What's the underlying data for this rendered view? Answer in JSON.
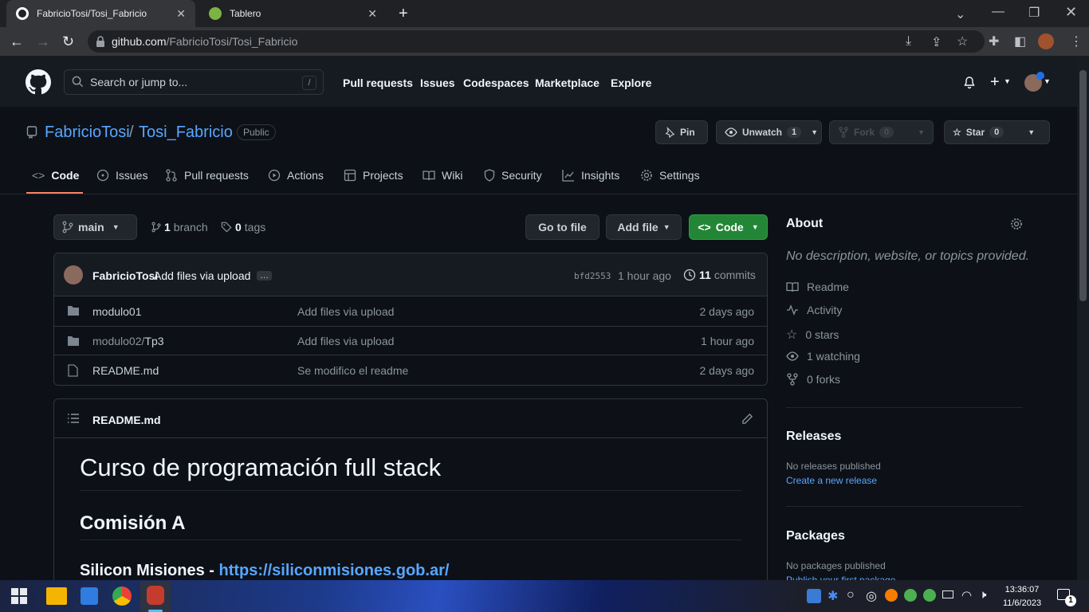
{
  "browser": {
    "tabs": [
      {
        "title": "FabricioTosi/Tosi_Fabricio"
      },
      {
        "title": "Tablero"
      }
    ],
    "url_host": "github.com",
    "url_path": "/FabricioTosi/Tosi_Fabricio"
  },
  "header": {
    "search_placeholder": "Search or jump to...",
    "slash": "/",
    "nav": [
      "Pull requests",
      "Issues",
      "Codespaces",
      "Marketplace",
      "Explore"
    ]
  },
  "repo": {
    "owner": "FabricioTosi",
    "separator": "/",
    "name": "Tosi_Fabricio",
    "visibility": "Public",
    "pin_label": "Pin",
    "unwatch_label": "Unwatch",
    "unwatch_count": "1",
    "fork_label": "Fork",
    "fork_count": "0",
    "star_label": "Star",
    "star_count": "0",
    "tabs": [
      "Code",
      "Issues",
      "Pull requests",
      "Actions",
      "Projects",
      "Wiki",
      "Security",
      "Insights",
      "Settings"
    ]
  },
  "code": {
    "branch": "main",
    "branch_count": "1",
    "branch_label": "branch",
    "tag_count": "0",
    "tag_label": "tags",
    "go_to_file": "Go to file",
    "add_file": "Add file",
    "code_button": "Code",
    "commit_author": "FabricioTosi",
    "commit_message": "Add files via upload",
    "commit_ellipsis": "…",
    "commit_sha": "bfd2553",
    "commit_time": "1 hour ago",
    "commit_count": "11",
    "commit_label": "commits",
    "files": [
      {
        "name": "modulo01",
        "sub": "",
        "message": "Add files via upload",
        "time": "2 days ago"
      },
      {
        "name": "modulo02/",
        "sub": "Tp3",
        "message": "Add files via upload",
        "time": "1 hour ago"
      },
      {
        "name": "README.md",
        "sub": "",
        "message": "Se modifico el readme",
        "time": "2 days ago"
      }
    ]
  },
  "readme": {
    "filename": "README.md",
    "h1": "Curso de programación full stack",
    "h2": "Comisión A",
    "h3_text": "Silicon Misiones - ",
    "h3_link": "https://siliconmisiones.gob.ar/"
  },
  "sidebar": {
    "about_title": "About",
    "about_desc": "No description, website, or topics provided.",
    "items": [
      "Readme",
      "Activity",
      "0 stars",
      "1 watching",
      "0 forks"
    ],
    "releases_title": "Releases",
    "releases_none": "No releases published",
    "releases_link": "Create a new release",
    "packages_title": "Packages",
    "packages_none": "No packages published",
    "packages_link": "Publish your first package"
  },
  "taskbar": {
    "time": "13:36:07",
    "date": "11/6/2023",
    "notifications": "1"
  },
  "colors": {
    "bg": "#0d1117",
    "header": "#161b22",
    "link": "#58a6ff",
    "code_button": "#238636",
    "tab_underline": "#f78166"
  }
}
